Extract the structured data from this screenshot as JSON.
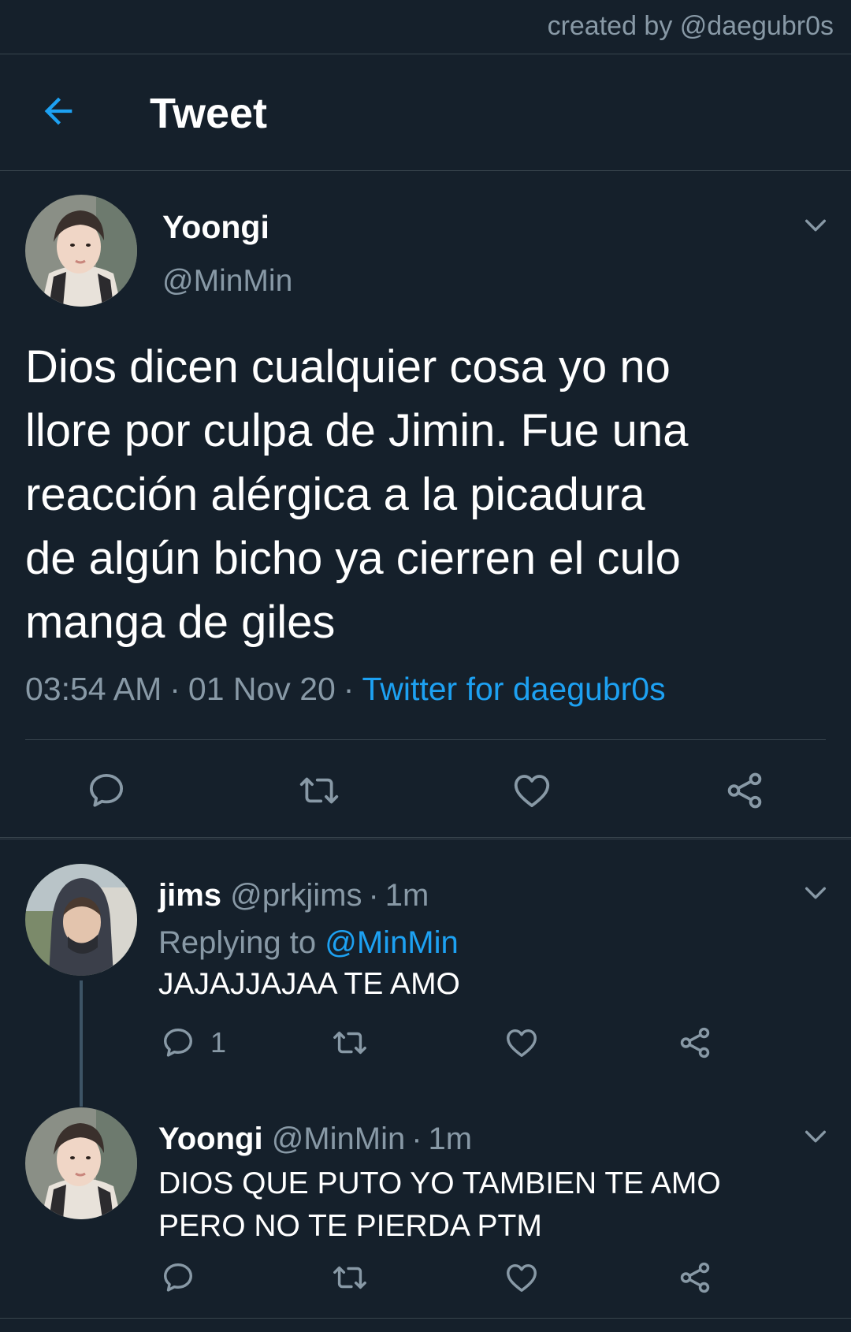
{
  "credit": "created by @daegubr0s",
  "header": {
    "title": "Tweet"
  },
  "main_tweet": {
    "name": "Yoongi",
    "handle": "@MinMin",
    "text": "Dios dicen cualquier cosa yo no\nllore por culpa de Jimin. Fue una\nreacción alérgica a la picadura\nde algún bicho ya cierren el culo\nmanga de giles",
    "time": "03:54 AM",
    "date": "01 Nov 20",
    "separator": "·",
    "source": "Twitter for daegubr0s"
  },
  "replies": [
    {
      "name": "jims",
      "handle": "@prkjims",
      "dot": "·",
      "time": "1m",
      "replying_label": "Replying to",
      "replying_to": "@MinMin",
      "text": "JAJAJJAJAA TE AMO",
      "reply_count": "1"
    },
    {
      "name": "Yoongi",
      "handle": "@MinMin",
      "dot": "·",
      "time": "1m",
      "text": "DIOS QUE PUTO YO TAMBIEN TE AMO\nPERO NO TE PIERDA PTM"
    }
  ],
  "icons": {
    "back": "arrow-left-icon",
    "caret": "chevron-down-icon",
    "reply": "reply-bubble-icon",
    "retweet": "retweet-icon",
    "like": "heart-icon",
    "share": "share-icon"
  },
  "colors": {
    "background": "#15202b",
    "divider": "#38444d",
    "text_primary": "#ffffff",
    "text_secondary": "#8899a6",
    "accent": "#1da1f2",
    "thread_line": "#3d5466"
  }
}
